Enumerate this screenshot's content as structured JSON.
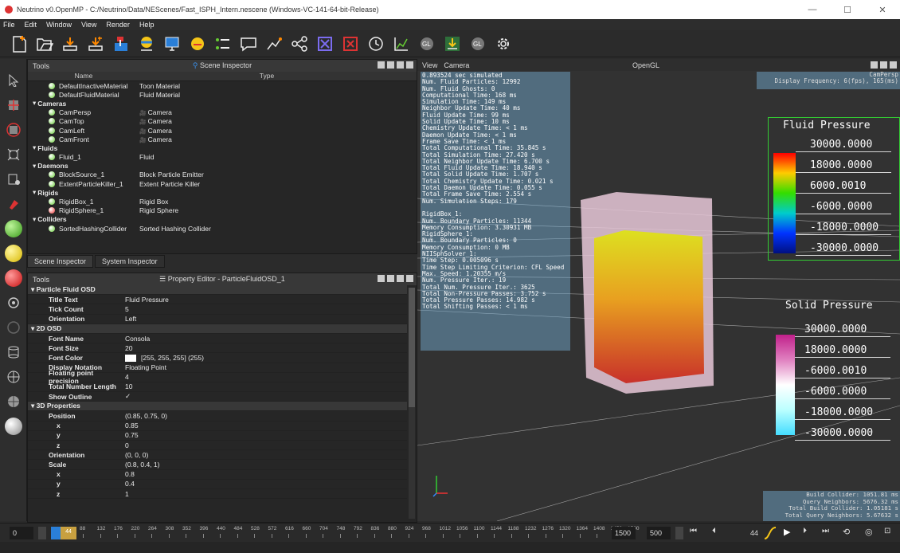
{
  "window": {
    "title": "Neutrino v0.OpenMP - C:/Neutrino/Data/NEScenes/Fast_ISPH_Intern.nescene (Windows-VC-141-64-bit-Release)",
    "minimize": "—",
    "maximize": "☐",
    "close": "✕"
  },
  "menu": [
    "File",
    "Edit",
    "Window",
    "View",
    "Render",
    "Help"
  ],
  "scene_panel": {
    "tools_label": "Tools",
    "title": "Scene Inspector",
    "col_name": "Name",
    "col_type": "Type",
    "rows": [
      {
        "indent": 2,
        "dot": "#6c3",
        "name": "DefaultInactiveMaterial",
        "type": "Toon Material",
        "cam": false
      },
      {
        "indent": 2,
        "dot": "#6c3",
        "name": "DefaultFluidMaterial",
        "type": "Fluid Material",
        "cam": false
      },
      {
        "indent": 1,
        "dot": "",
        "name": "Cameras",
        "type": "",
        "cam": false,
        "group": true
      },
      {
        "indent": 2,
        "dot": "#6c3",
        "name": "CamPersp",
        "type": "Camera",
        "cam": true
      },
      {
        "indent": 2,
        "dot": "#6c3",
        "name": "CamTop",
        "type": "Camera",
        "cam": true
      },
      {
        "indent": 2,
        "dot": "#6c3",
        "name": "CamLeft",
        "type": "Camera",
        "cam": true
      },
      {
        "indent": 2,
        "dot": "#6c3",
        "name": "CamFront",
        "type": "Camera",
        "cam": true
      },
      {
        "indent": 1,
        "dot": "",
        "name": "Fluids",
        "type": "",
        "cam": false,
        "group": true
      },
      {
        "indent": 2,
        "dot": "#6c3",
        "name": "Fluid_1",
        "type": "Fluid",
        "cam": false
      },
      {
        "indent": 1,
        "dot": "",
        "name": "Daemons",
        "type": "",
        "cam": false,
        "group": true
      },
      {
        "indent": 2,
        "dot": "#6c3",
        "name": "BlockSource_1",
        "type": "Block Particle Emitter",
        "cam": false
      },
      {
        "indent": 2,
        "dot": "#6c3",
        "name": "ExtentParticleKiller_1",
        "type": "Extent Particle Killer",
        "cam": false
      },
      {
        "indent": 1,
        "dot": "",
        "name": "Rigids",
        "type": "",
        "cam": false,
        "group": true
      },
      {
        "indent": 2,
        "dot": "#6c3",
        "name": "RigidBox_1",
        "type": "Rigid Box",
        "cam": false
      },
      {
        "indent": 2,
        "dot": "#e33",
        "name": "RigidSphere_1",
        "type": "Rigid Sphere",
        "cam": false
      },
      {
        "indent": 1,
        "dot": "",
        "name": "Colliders",
        "type": "",
        "cam": false,
        "group": true
      },
      {
        "indent": 2,
        "dot": "#6c3",
        "name": "SortedHashingCollider",
        "type": "Sorted Hashing Collider",
        "cam": false
      }
    ],
    "tabs": [
      "Scene Inspector",
      "System Inspector"
    ]
  },
  "property_panel": {
    "tools_label": "Tools",
    "title": "Property Editor - ParticleFluidOSD_1",
    "rows": [
      {
        "sec": true,
        "k": "Particle Fluid OSD",
        "v": ""
      },
      {
        "k": "Title Text",
        "v": "Fluid Pressure"
      },
      {
        "k": "Tick Count",
        "v": "5"
      },
      {
        "k": "Orientation",
        "v": "Left"
      },
      {
        "sec": true,
        "k": "2D OSD",
        "v": ""
      },
      {
        "k": "Font Name",
        "v": "Consola"
      },
      {
        "k": "Font Size",
        "v": "20"
      },
      {
        "k": "Font Color",
        "v": "[255, 255, 255] (255)",
        "swatch": true
      },
      {
        "k": "Display Notation",
        "v": "Floating Point"
      },
      {
        "k": "Floating point precision",
        "v": "4"
      },
      {
        "k": "Total Number Length",
        "v": "10"
      },
      {
        "k": "Show Outline",
        "v": "✓"
      },
      {
        "sec": true,
        "k": "3D Properties",
        "v": ""
      },
      {
        "k": "Position",
        "v": "(0.85, 0.75, 0)"
      },
      {
        "k": "x",
        "v": "0.85",
        "sub": true
      },
      {
        "k": "y",
        "v": "0.75",
        "sub": true
      },
      {
        "k": "z",
        "v": "0",
        "sub": true
      },
      {
        "k": "Orientation",
        "v": "(0, 0, 0)"
      },
      {
        "k": "Scale",
        "v": "(0.8, 0.4, 1)"
      },
      {
        "k": "x",
        "v": "0.8",
        "sub": true
      },
      {
        "k": "y",
        "v": "0.4",
        "sub": true
      },
      {
        "k": "z",
        "v": "1",
        "sub": true
      }
    ]
  },
  "viewport": {
    "menu_view": "View",
    "menu_camera": "Camera",
    "title": "OpenGL",
    "cam_name": "CamPersp",
    "display_freq": "Display Frequency: 6(fps), 165(ms)",
    "osd_text": "0.893524 sec simulated\nNum. Fluid Particles: 12992\nNum. Fluid Ghosts: 0\nComputational Time: 168 ms\nSimulation Time: 149 ms\nNeighbor Update Time: 40 ms\nFluid Update Time: 99 ms\nSolid Update Time: 10 ms\nChemistry Update Time: < 1 ms\nDaemon Update Time: < 1 ms\nFrame Save Time: < 1 ms\nTotal Computational Time: 35.845 s\nTotal Simulation Time: 27.420 s\nTotal Neighbor Update Time: 6.700 s\nTotal Fluid Update Time: 18.940 s\nTotal Solid Update Time: 1.707 s\nTotal Chemistry Update Time: 0.021 s\nTotal Daemon Update Time: 0.055 s\nTotal Frame Save Time: 2.554 s\nNum. Simulation Steps: 179\n\nRigidBox_1:\nNum. Boundary Particles: 11344\nMemory Consumption: 3.30931 MB\nRigidSphere_1:\nNum. Boundary Particles: 0\nMemory Consumption: 0 MB\nNIISphSolver_1:\nTime Step: 0.005096 s\nTime Step Limiting Criterion: CFL Speed\nMax. Speed: 1.20355 m/s\nNum. Pressure Iter.: 19\nTotal Num. Pressure Iter.: 3625\nTotal Non-Pressure Passes: 3.752 s\nTotal Pressure Passes: 14.982 s\nTotal Shifting Passes: < 1 ms",
    "fluid_legend": {
      "title": "Fluid Pressure",
      "ticks": [
        "30000.0000",
        "18000.0000",
        "6000.0010",
        "-6000.0000",
        "-18000.0000",
        "-30000.0000"
      ]
    },
    "solid_legend": {
      "title": "Solid Pressure",
      "ticks": [
        "30000.0000",
        "18000.0000",
        "-6000.0010",
        "-6000.0000",
        "-18000.0000",
        "-30000.0000"
      ]
    },
    "collider_stats": [
      "Build Collider: 1051.81 ms",
      "Query Neighbors: 5676.32 ms",
      "Total Build Collider: 1.05181 s",
      "Total Query Neighbors: 5.67632 s"
    ]
  },
  "timeline": {
    "start": "0",
    "current_marker": "44",
    "ticks": [
      "88",
      "132",
      "176",
      "220",
      "264",
      "308",
      "352",
      "396",
      "440",
      "484",
      "528",
      "572",
      "616",
      "660",
      "704",
      "748",
      "792",
      "836",
      "880",
      "924",
      "968",
      "1012",
      "1056",
      "1100",
      "1144",
      "1188",
      "1232",
      "1276",
      "1320",
      "1364",
      "1408",
      "1452",
      "1500"
    ],
    "end": "1500",
    "fps": "500",
    "frame": "44"
  },
  "colors": {
    "accent_green": "#6c3",
    "accent_red": "#e33",
    "osd_bg": "#78b4dc"
  }
}
